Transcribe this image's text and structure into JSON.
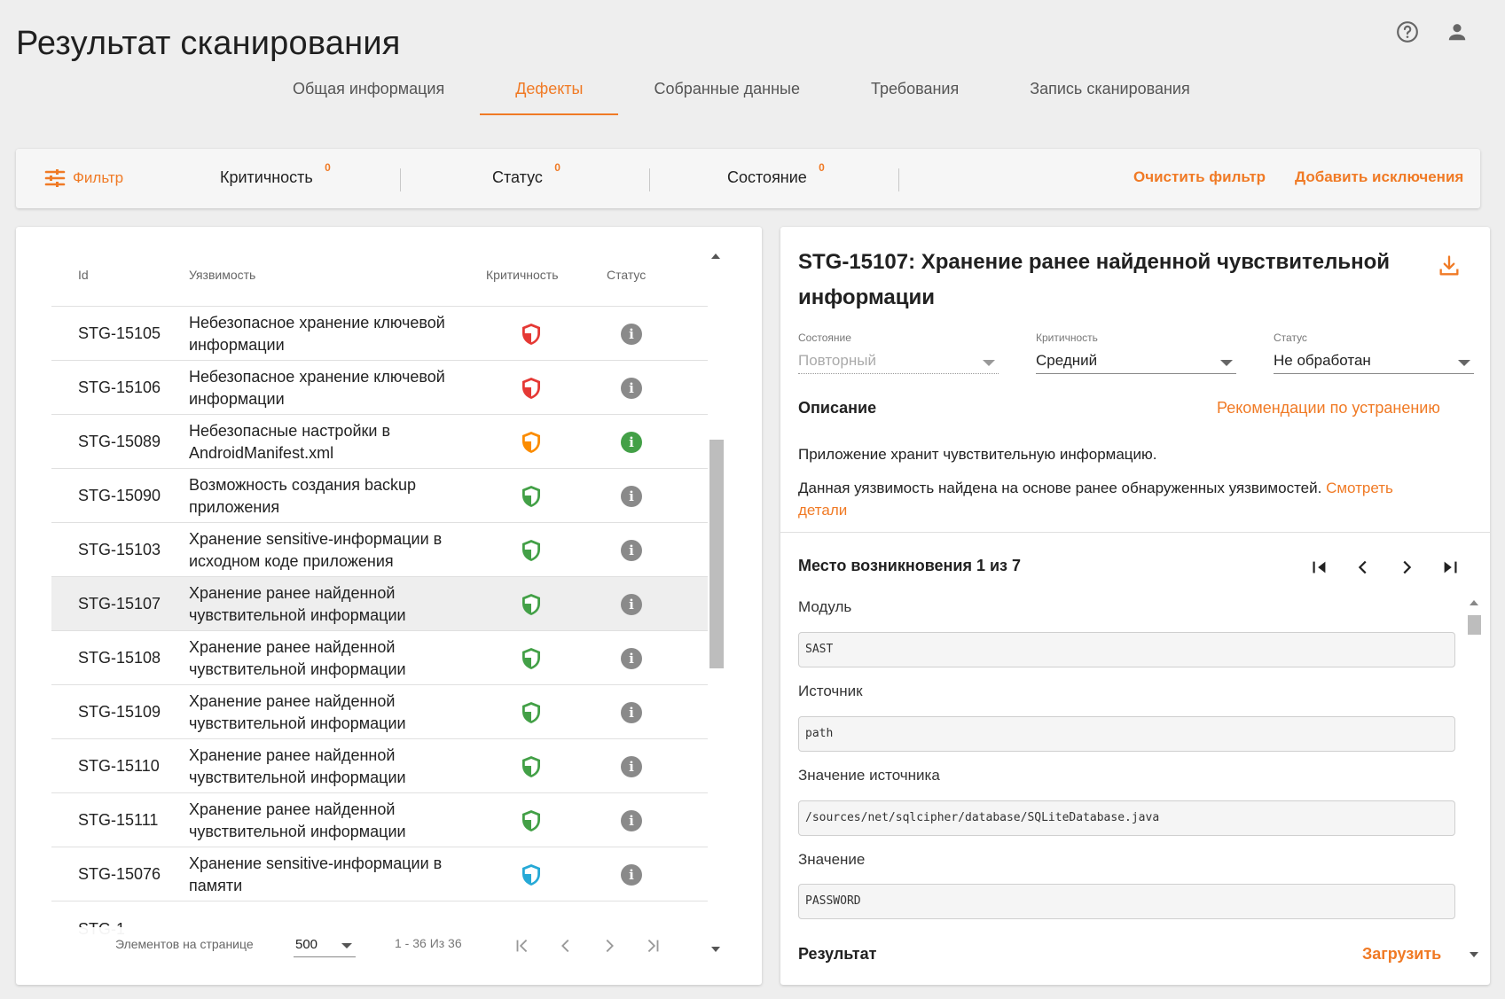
{
  "page": {
    "title": "Результат сканирования"
  },
  "tabs": [
    {
      "label": "Общая информация",
      "active": false
    },
    {
      "label": "Дефекты",
      "active": true
    },
    {
      "label": "Собранные данные",
      "active": false
    },
    {
      "label": "Требования",
      "active": false
    },
    {
      "label": "Запись сканирования",
      "active": false
    }
  ],
  "filter": {
    "button_label": "Фильтр",
    "chips": [
      {
        "label": "Критичность",
        "count": "0"
      },
      {
        "label": "Статус",
        "count": "0"
      },
      {
        "label": "Состояние",
        "count": "0"
      }
    ],
    "clear_label": "Очистить фильтр",
    "add_exclusions_label": "Добавить исключения"
  },
  "table": {
    "headers": {
      "id": "Id",
      "vuln": "Уязвимость",
      "crit": "Критичность",
      "status": "Статус"
    },
    "rows": [
      {
        "id": "STG-15105",
        "name": "Небезопасное хранение ключевой информации",
        "criticality": "high",
        "status": "info",
        "selected": false
      },
      {
        "id": "STG-15106",
        "name": "Небезопасное хранение ключевой информации",
        "criticality": "high",
        "status": "info",
        "selected": false
      },
      {
        "id": "STG-15089",
        "name": "Небезопасные настройки в AndroidManifest.xml",
        "criticality": "medium-high",
        "status": "info-green",
        "selected": false
      },
      {
        "id": "STG-15090",
        "name": "Возможность создания backup приложения",
        "criticality": "medium",
        "status": "info",
        "selected": false
      },
      {
        "id": "STG-15103",
        "name": "Хранение sensitive-информации в исходном коде приложения",
        "criticality": "medium",
        "status": "info",
        "selected": false
      },
      {
        "id": "STG-15107",
        "name": "Хранение ранее найденной чувствительной информации",
        "criticality": "medium",
        "status": "info",
        "selected": true
      },
      {
        "id": "STG-15108",
        "name": "Хранение ранее найденной чувствительной информации",
        "criticality": "medium",
        "status": "info",
        "selected": false
      },
      {
        "id": "STG-15109",
        "name": "Хранение ранее найденной чувствительной информации",
        "criticality": "medium",
        "status": "info",
        "selected": false
      },
      {
        "id": "STG-15110",
        "name": "Хранение ранее найденной чувствительной информации",
        "criticality": "medium",
        "status": "info",
        "selected": false
      },
      {
        "id": "STG-15111",
        "name": "Хранение ранее найденной чувствительной информации",
        "criticality": "medium",
        "status": "info",
        "selected": false
      },
      {
        "id": "STG-15076",
        "name": "Хранение sensitive-информации в памяти",
        "criticality": "low",
        "status": "info",
        "selected": false
      }
    ],
    "partial_row_id": "STG-1"
  },
  "pagination": {
    "items_per_page_label": "Элементов на странице",
    "items_per_page_value": "500",
    "range": "1 - 36 Из 36"
  },
  "detail": {
    "title": "STG-15107: Хранение ранее найденной чувствительной информации",
    "fields": {
      "state": {
        "label": "Состояние",
        "value": "Повторный"
      },
      "criticality": {
        "label": "Критичность",
        "value": "Средний"
      },
      "status": {
        "label": "Статус",
        "value": "Не обработан"
      }
    },
    "description_heading": "Описание",
    "remediation_link": "Рекомендации по устранению",
    "description_text": "Приложение хранит чувствительную информацию.",
    "found_text": "Данная уязвимость найдена на основе ранее обнаруженных уязвимостей.",
    "details_link_1": "Смотреть",
    "details_link_2": "детали",
    "occurrence_label": "Место возникновения 1 из 7",
    "module_label": "Модуль",
    "module_value": "SAST",
    "source_label": "Источник",
    "source_value": "path",
    "source_value_label": "Значение источника",
    "source_value_value": "/sources/net/sqlcipher/database/SQLiteDatabase.java",
    "value_label": "Значение",
    "value_value": "PASSWORD",
    "result_label": "Результат",
    "download_label": "Загрузить"
  },
  "colors": {
    "accent": "#f07a25",
    "crit_high": "#e53935",
    "crit_medium_high": "#fb8c00",
    "crit_medium": "#43a047",
    "crit_low": "#26a9d6",
    "status_info": "#8a8a8a",
    "status_info_green": "#43a047"
  }
}
